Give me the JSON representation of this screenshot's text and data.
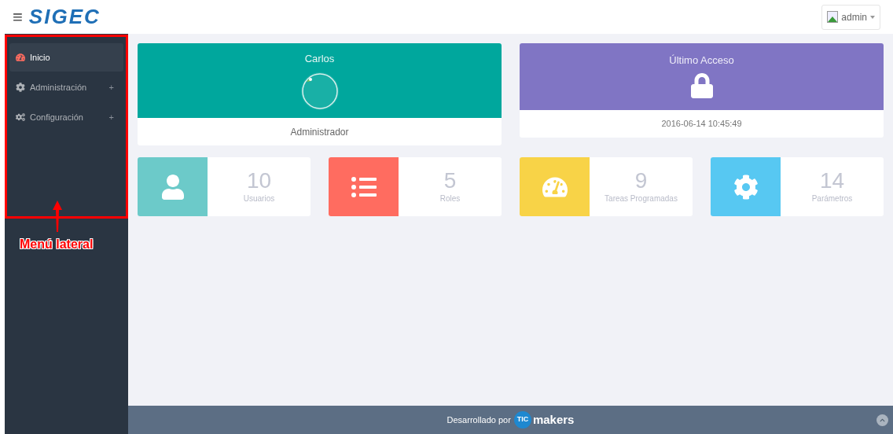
{
  "header": {
    "menu_icon": "≡",
    "logo": "SIGEC",
    "user": "admin"
  },
  "sidebar": {
    "items": [
      {
        "label": "Inicio",
        "kind": "gauge",
        "selected": true
      },
      {
        "label": "Administración",
        "kind": "gear",
        "selected": false,
        "toggle": "+"
      },
      {
        "label": "Configuración",
        "kind": "gears",
        "selected": false,
        "toggle": "+"
      }
    ]
  },
  "annotation": {
    "label": "Menú lateral"
  },
  "profile_card": {
    "name": "Carlos",
    "role": "Administrador"
  },
  "access_card": {
    "title": "Último Acceso",
    "value": "2016-06-14 10:45:49"
  },
  "stats": [
    {
      "value": "10",
      "label": "Usuarios",
      "kind": "user",
      "color": "#6ccac9"
    },
    {
      "value": "5",
      "label": "Roles",
      "kind": "list",
      "color": "#ff6c60"
    },
    {
      "value": "9",
      "label": "Tareas Programadas",
      "kind": "gauge",
      "color": "#f8d347"
    },
    {
      "value": "14",
      "label": "Parámetros",
      "kind": "gear",
      "color": "#57c8f2"
    }
  ],
  "footer": {
    "text": "Desarrollado por",
    "brand_mark": "TIC",
    "brand_name": "makers"
  }
}
